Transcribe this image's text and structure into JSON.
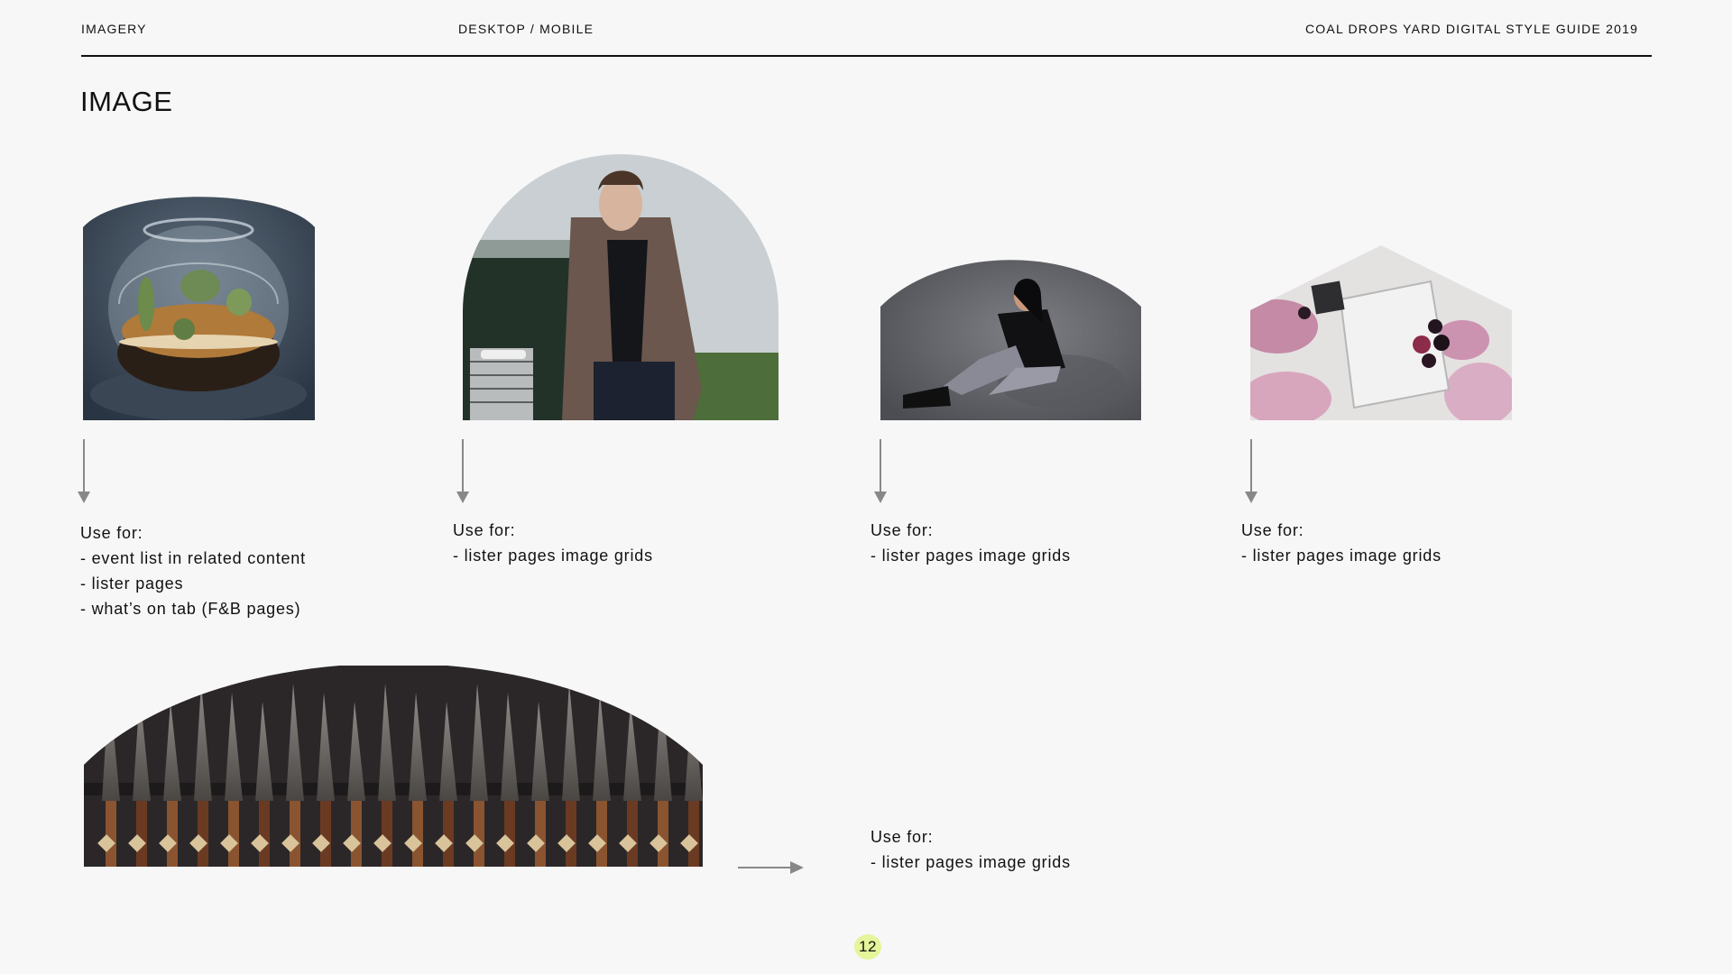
{
  "header": {
    "section": "IMAGERY",
    "platform": "DESKTOP / MOBILE",
    "guide": "COAL DROPS YARD DIGITAL STYLE GUIDE 2019"
  },
  "page_title": "IMAGE",
  "cards": [
    {
      "image": "terrarium-image",
      "heading": "Use for:",
      "lines": [
        "- event list in related content",
        "- lister pages",
        "- what’s on tab (F&B pages)"
      ]
    },
    {
      "image": "man-in-coat-image",
      "heading": "Use for:",
      "lines": [
        "- lister pages image grids"
      ]
    },
    {
      "image": "woman-sitting-image",
      "heading": "Use for:",
      "lines": [
        "- lister pages image grids"
      ]
    },
    {
      "image": "perfume-flowers-image",
      "heading": "Use for:",
      "lines": [
        "- lister pages image grids"
      ]
    },
    {
      "image": "knives-image",
      "heading": "Use for:",
      "lines": [
        "- lister pages image grids"
      ]
    }
  ],
  "page_number": "12",
  "colors": {
    "page_number_highlight": "#e4f59a",
    "arrow": "#888888"
  }
}
